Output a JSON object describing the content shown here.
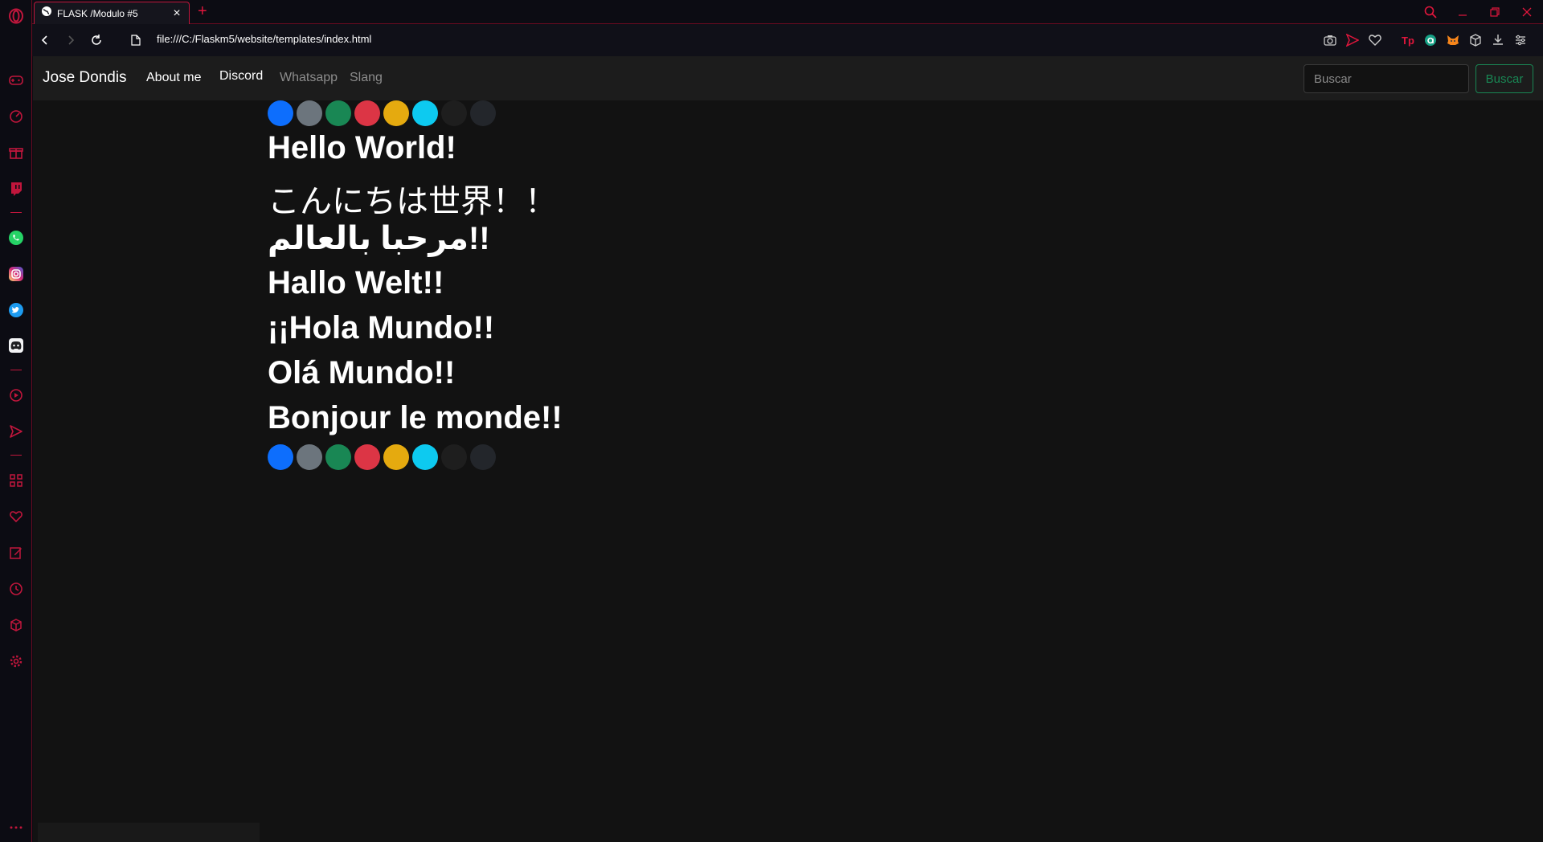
{
  "browser": {
    "tab_title": "FLASK /Modulo #5",
    "url": "file:///C:/Flaskm5/website/templates/index.html",
    "accent_color": "#e0163c"
  },
  "sidebar": {
    "icons": [
      "opera-logo-icon",
      "gamepad-icon",
      "speed-dial-icon",
      "gift-icon",
      "twitch-icon",
      "whatsapp-icon",
      "instagram-icon",
      "twitter-icon",
      "discord-icon",
      "player-icon",
      "send-icon",
      "apps-icon",
      "heart-icon",
      "edit-icon",
      "history-icon",
      "cube-icon",
      "settings-icon",
      "more-icon"
    ]
  },
  "navbar": {
    "brand": "Jose Dondis",
    "links": [
      {
        "label": "About me",
        "active": true
      },
      {
        "label": "Discord",
        "active": true
      },
      {
        "label": "Whatsapp",
        "active": false
      },
      {
        "label": "Slang",
        "active": false
      }
    ],
    "search_placeholder": "Buscar",
    "search_button": "Buscar"
  },
  "color_dots": [
    "#0d6efd",
    "#6c757d",
    "#198754",
    "#dc3545",
    "#e5aa0f",
    "#0dcaf0",
    "#1e1e1e",
    "#23262b"
  ],
  "greetings": [
    "Hello World!",
    "こんにちは世界！！",
    "مرحبا بالعالم!!",
    "Hallo Welt!!",
    "¡¡Hola Mundo!!",
    "Olá Mundo!!",
    "Bonjour le monde!!"
  ]
}
